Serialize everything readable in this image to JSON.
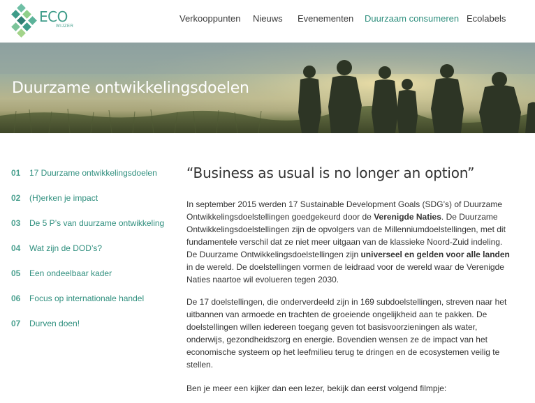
{
  "header": {
    "logo_text": "ECO",
    "logo_sub": "WIJZER",
    "nav": [
      {
        "label": "Verkooppunten",
        "active": false
      },
      {
        "label": "Nieuws",
        "active": false
      },
      {
        "label": "Evenementen",
        "active": false
      },
      {
        "label": "Duurzaam consumeren",
        "active": true
      },
      {
        "label": "Ecolabels",
        "active": false
      }
    ]
  },
  "hero": {
    "title": "Duurzame ontwikkelingsdoelen"
  },
  "sidebar": {
    "items": [
      {
        "num": "01",
        "label": "17 Duurzame ontwikkelingsdoelen"
      },
      {
        "num": "02",
        "label": "(H)erken je impact"
      },
      {
        "num": "03",
        "label": "De 5 P’s van duurzame ontwikkeling"
      },
      {
        "num": "04",
        "label": "Wat zijn de DOD’s?"
      },
      {
        "num": "05",
        "label": "Een ondeelbaar kader"
      },
      {
        "num": "06",
        "label": "Focus op internationale handel"
      },
      {
        "num": "07",
        "label": "Durven doen!"
      }
    ]
  },
  "main": {
    "quote": "“Business as usual is no longer an option”",
    "p1": {
      "t1": "In september 2015 werden 17 Sustainable Development Goals (SDG’s) of Duurzame Ontwikkelingsdoelstellingen goedgekeurd door de ",
      "b1": "Verenigde Naties",
      "t2": ". De Duurzame Ontwikkelingsdoelstellingen zijn de opvolgers van de Millenniumdoelstellingen, met dit fundamentele verschil dat ze niet meer uitgaan van de klassieke Noord-Zuid indeling. De Duurzame Ontwikkelingsdoelstellingen zijn ",
      "b2": "universeel en gelden voor alle landen",
      "t3": " in de wereld. De doelstellingen vormen de leidraad voor de wereld waar de Verenigde Naties naartoe wil evolueren tegen 2030."
    },
    "p2": "De 17 doelstellingen, die onderverdeeld zijn in 169 subdoelstellingen, streven naar het uitbannen van armoede en trachten de groeiende ongelijkheid aan te pakken. De doelstellingen willen iedereen toegang geven tot basisvoorzieningen als water, onderwijs, gezondheidszorg en energie. Bovendien wensen ze de impact van het economische systeem op het leefmilieu terug te dringen en de ecosystemen veilig te stellen.",
    "p3": "Ben je meer een kijker dan een lezer, bekijk dan eerst volgend filmpje:"
  }
}
